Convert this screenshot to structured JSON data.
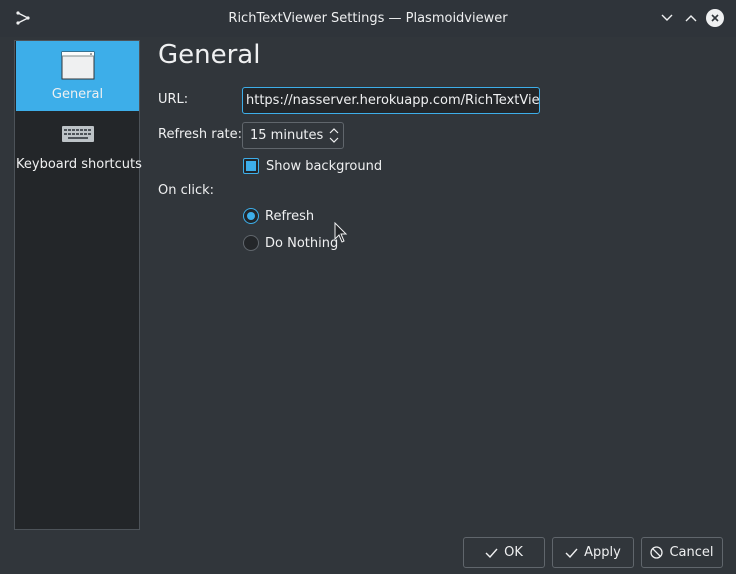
{
  "window": {
    "title": "RichTextViewer Settings — Plasmoidviewer",
    "app_icon": "plasma-icon",
    "controls": [
      "chevron-down-icon",
      "chevron-up-icon",
      "close-icon"
    ]
  },
  "sidebar": {
    "items": [
      {
        "label": "General",
        "icon": "window-icon",
        "active": true
      },
      {
        "label": "Keyboard shortcuts",
        "icon": "keyboard-icon",
        "active": false
      }
    ]
  },
  "main": {
    "page_title": "General",
    "url_label": "URL:",
    "url_value": "https://nasserver.herokuapp.com/RichTextViewer",
    "refresh_label": "Refresh rate:",
    "refresh_value": "15 minutes",
    "show_background_label": "Show background",
    "show_background_checked": true,
    "on_click_label": "On click:",
    "on_click_options": [
      {
        "label": "Refresh",
        "selected": true
      },
      {
        "label": "Do Nothing",
        "selected": false
      }
    ]
  },
  "buttons": {
    "ok": "OK",
    "apply": "Apply",
    "cancel": "Cancel"
  },
  "colors": {
    "accent": "#3daee9",
    "window_bg": "#31363b",
    "sidebar_bg": "#232629",
    "text": "#eff0f1"
  }
}
